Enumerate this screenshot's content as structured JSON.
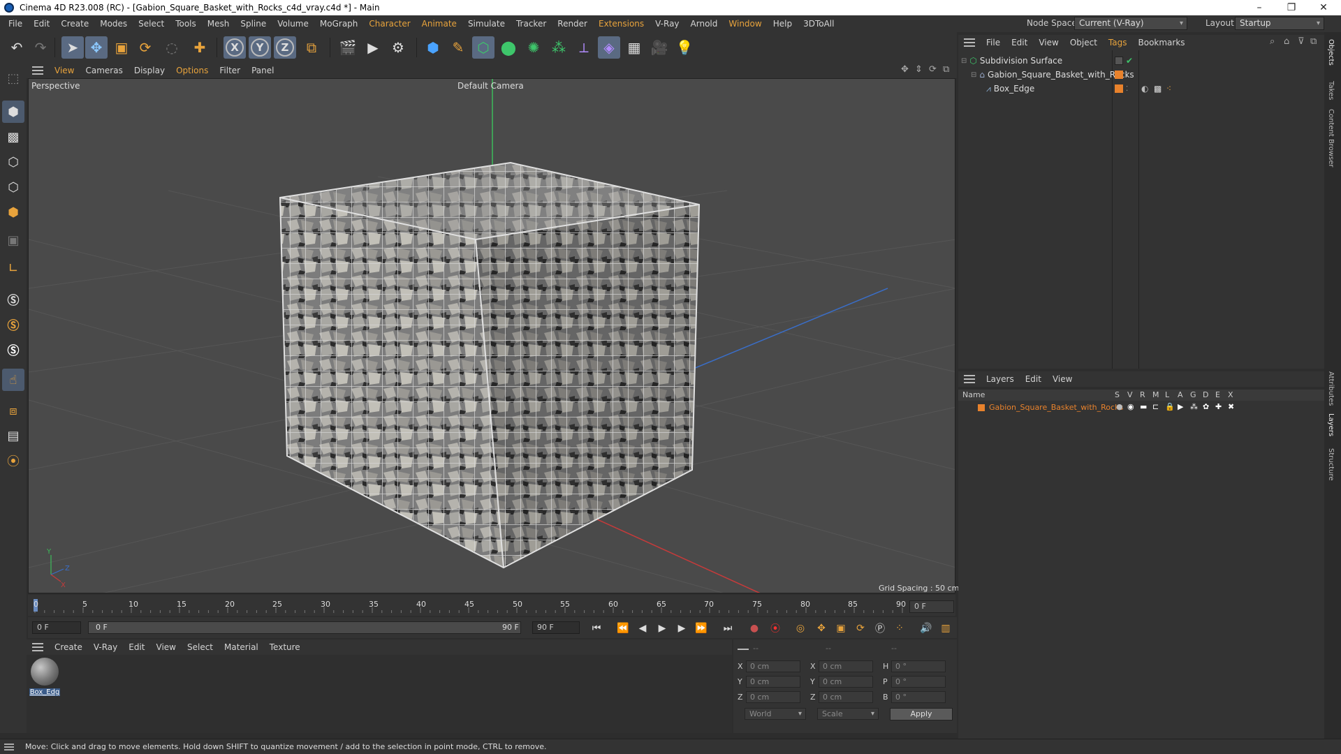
{
  "window": {
    "title": "Cinema 4D R23.008 (RC) - [Gabion_Square_Basket_with_Rocks_c4d_vray.c4d *] - Main",
    "minimize": "–",
    "maximize": "❐",
    "close": "✕"
  },
  "menubar": {
    "items": [
      "File",
      "Edit",
      "Create",
      "Modes",
      "Select",
      "Tools",
      "Mesh",
      "Spline",
      "Volume",
      "MoGraph",
      "Character",
      "Animate",
      "Simulate",
      "Tracker",
      "Render",
      "Extensions",
      "V-Ray",
      "Arnold",
      "Window",
      "Help",
      "3DToAll"
    ],
    "node_space_label": "Node Space:",
    "node_space_value": "Current (V-Ray)",
    "layout_label": "Layout:",
    "layout_value": "Startup"
  },
  "viewport": {
    "menu": [
      "View",
      "Cameras",
      "Display",
      "Options",
      "Filter",
      "Panel"
    ],
    "label": "Perspective",
    "camera": "Default Camera",
    "grid_spacing": "Grid Spacing : 50 cm",
    "axis_y": "Y",
    "axis_z": "Z",
    "axis_x": "X"
  },
  "timeline": {
    "ticks": [
      "0",
      "5",
      "10",
      "15",
      "20",
      "25",
      "30",
      "35",
      "40",
      "45",
      "50",
      "55",
      "60",
      "65",
      "70",
      "75",
      "80",
      "85",
      "90"
    ],
    "current_frame": "0 F"
  },
  "transport": {
    "start_field": "0 F",
    "range_start": "0 F",
    "range_end": "90 F",
    "end_field": "90 F"
  },
  "materials": {
    "menu": [
      "Create",
      "V-Ray",
      "Edit",
      "View",
      "Select",
      "Material",
      "Texture"
    ],
    "items": [
      {
        "name": "Box_Edg"
      }
    ]
  },
  "coordinates": {
    "header": [
      "--",
      "--",
      "--"
    ],
    "rows": [
      {
        "pos_label": "X",
        "pos": "0 cm",
        "size_label": "X",
        "size": "0 cm",
        "rot_label": "H",
        "rot": "0 °"
      },
      {
        "pos_label": "Y",
        "pos": "0 cm",
        "size_label": "Y",
        "size": "0 cm",
        "rot_label": "P",
        "rot": "0 °"
      },
      {
        "pos_label": "Z",
        "pos": "0 cm",
        "size_label": "Z",
        "size": "0 cm",
        "rot_label": "B",
        "rot": "0 °"
      }
    ],
    "mode": "World",
    "scale": "Scale",
    "apply": "Apply"
  },
  "objects": {
    "menu": [
      "File",
      "Edit",
      "View",
      "Object",
      "Tags",
      "Bookmarks"
    ],
    "rows": [
      {
        "name": "Subdivision Surface",
        "indent": 0
      },
      {
        "name": "Gabion_Square_Basket_with_Rocks",
        "indent": 1
      },
      {
        "name": "Box_Edge",
        "indent": 2
      }
    ]
  },
  "layers": {
    "menu": [
      "Layers",
      "Edit",
      "View"
    ],
    "columns": [
      "Name",
      "S",
      "V",
      "R",
      "M",
      "L",
      "A",
      "G",
      "D",
      "E",
      "X"
    ],
    "rows": [
      {
        "name": "Gabion_Square_Basket_with_Rocks"
      }
    ]
  },
  "side_tabs": [
    "Objects",
    "Takes",
    "Content Browser",
    "Attributes",
    "Layers",
    "Structure"
  ],
  "status": {
    "text": "Move: Click and drag to move elements. Hold down SHIFT to quantize movement / add to the selection in point mode, CTRL to remove."
  },
  "colors": {
    "accent": "#e8a33c",
    "layer": "#e8822c",
    "selection": "#3b5c8a"
  }
}
